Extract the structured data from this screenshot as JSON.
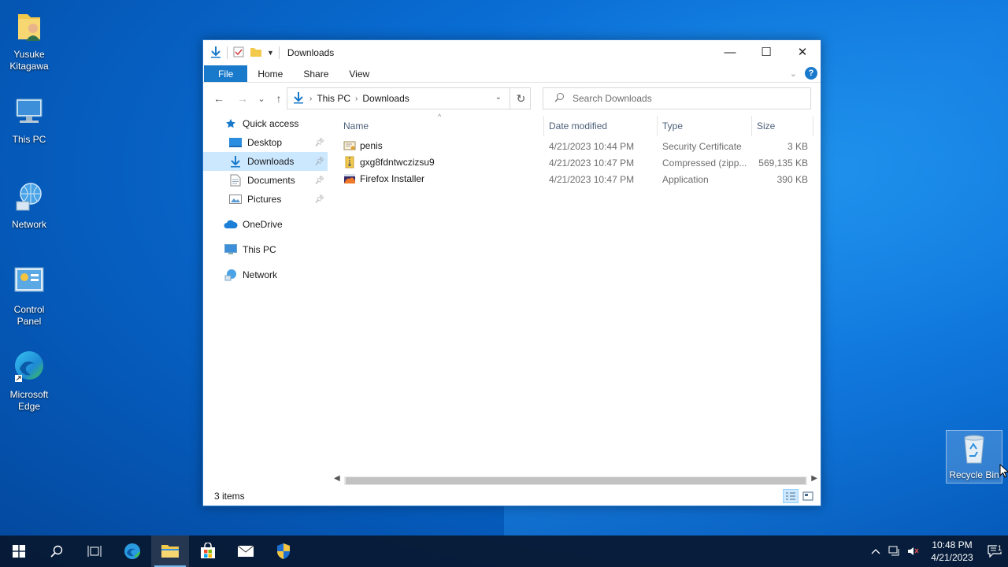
{
  "desktop": {
    "icons": [
      {
        "label": "Yusuke\nKitagawa",
        "icon": "user-folder-icon"
      },
      {
        "label": "This PC",
        "icon": "computer-icon"
      },
      {
        "label": "Network",
        "icon": "network-globe-icon"
      },
      {
        "label": "Control\nPanel",
        "icon": "control-panel-icon"
      },
      {
        "label": "Microsoft\nEdge",
        "icon": "edge-icon"
      },
      {
        "label": "Recycle Bin",
        "icon": "recycle-bin-icon"
      }
    ]
  },
  "window": {
    "title": "Downloads",
    "controls": {
      "minimize": "—",
      "maximize": "☐",
      "close": "✕"
    }
  },
  "ribbon": {
    "tabs": [
      "File",
      "Home",
      "Share",
      "View"
    ]
  },
  "navigation": {
    "back": "←",
    "forward": "→",
    "recent": "⌄",
    "up": "↑",
    "breadcrumb": [
      "This PC",
      "Downloads"
    ],
    "refresh": "↻",
    "search_placeholder": "Search Downloads"
  },
  "navpane": {
    "quick_access": "Quick access",
    "quick_items": [
      {
        "label": "Desktop",
        "pinned": true,
        "selected": false
      },
      {
        "label": "Downloads",
        "pinned": true,
        "selected": true
      },
      {
        "label": "Documents",
        "pinned": true,
        "selected": false
      },
      {
        "label": "Pictures",
        "pinned": true,
        "selected": false
      }
    ],
    "onedrive": "OneDrive",
    "thispc": "This PC",
    "network": "Network"
  },
  "files": {
    "columns": {
      "name": "Name",
      "date": "Date modified",
      "type": "Type",
      "size": "Size"
    },
    "rows": [
      {
        "name": "penis",
        "date": "4/21/2023 10:44 PM",
        "type": "Security Certificate",
        "size": "3 KB",
        "icon": "certificate-icon"
      },
      {
        "name": "gxg8fdntwczizsu9",
        "date": "4/21/2023 10:47 PM",
        "type": "Compressed (zipp...",
        "size": "569,135 KB",
        "icon": "zip-folder-icon"
      },
      {
        "name": "Firefox Installer",
        "date": "4/21/2023 10:47 PM",
        "type": "Application",
        "size": "390 KB",
        "icon": "firefox-icon"
      }
    ]
  },
  "status": {
    "item_count": "3 items"
  },
  "taskbar": {
    "clock_time": "10:48 PM",
    "clock_date": "4/21/2023",
    "notification_count": "1"
  },
  "colors": {
    "accent": "#1979ca",
    "selection": "#cce8ff",
    "taskbar": "#081830"
  }
}
